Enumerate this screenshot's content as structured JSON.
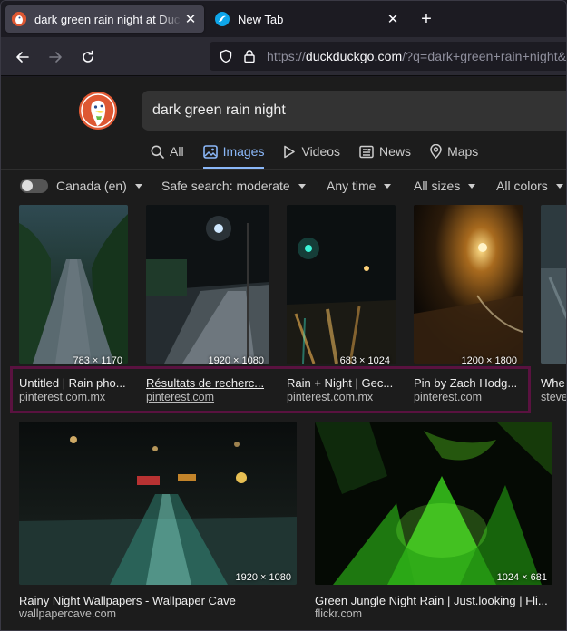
{
  "browser": {
    "tabs": [
      {
        "title": "dark green rain night at DuckDuckGo",
        "close": "✕",
        "active": true
      },
      {
        "title": "New Tab",
        "close": "✕",
        "active": false
      }
    ],
    "new_tab_symbol": "+",
    "url_prefix": "https://",
    "url_domain": "duckduckgo.com",
    "url_rest": "/?q=dark+green+rain+night&t=h_&iax=images&ia=images"
  },
  "search": {
    "query": "dark green rain night"
  },
  "verticals": [
    {
      "label": "All",
      "icon": "search-icon"
    },
    {
      "label": "Images",
      "icon": "image-icon",
      "selected": true
    },
    {
      "label": "Videos",
      "icon": "play-icon"
    },
    {
      "label": "News",
      "icon": "newspaper-icon"
    },
    {
      "label": "Maps",
      "icon": "map-pin-icon"
    }
  ],
  "filters": {
    "region": "Canada (en)",
    "safe_search": "Safe search: moderate",
    "time": "Any time",
    "size": "All sizes",
    "color": "All colors"
  },
  "results_row1": [
    {
      "title": "Untitled | Rain pho...",
      "source": "pinterest.com.mx",
      "dims": "783 × 1170"
    },
    {
      "title": "Résultats de recherc...",
      "source": "pinterest.com",
      "dims": "1920 × 1080"
    },
    {
      "title": "Rain + Night | Gec...",
      "source": "pinterest.com.mx",
      "dims": "683 × 1024"
    },
    {
      "title": "Pin by Zach Hodg...",
      "source": "pinterest.com",
      "dims": "1200 × 1800"
    },
    {
      "title": "Whe",
      "source": "steve",
      "dims": ""
    }
  ],
  "results_row2": [
    {
      "title": "Rainy Night Wallpapers - Wallpaper Cave",
      "source": "wallpapercave.com",
      "dims": "1920 × 1080"
    },
    {
      "title": "Green Jungle Night Rain | Just.looking | Fli...",
      "source": "flickr.com",
      "dims": "1024 × 681"
    }
  ],
  "colors": {
    "accent": "#8bb8f9",
    "brand": "#de5833",
    "highlight": "#5a1240"
  }
}
